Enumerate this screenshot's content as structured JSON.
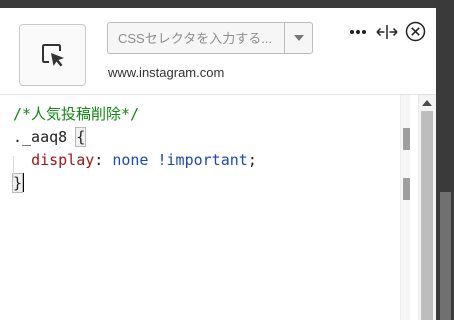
{
  "toolbar": {
    "element_picker_icon": "cursor-select-icon",
    "css_selector_placeholder": "CSSセレクタを入力する...",
    "dropdown_icon": "chevron-down-icon",
    "site_url": "www.instagram.com",
    "more_icon": "more-horizontal-icon",
    "resize_icon": "resize-horizontal-icon",
    "close_icon": "close-circle-icon"
  },
  "editor": {
    "lines": [
      {
        "comment": "/*人気投稿削除*/"
      },
      {
        "selector": "._aaq8",
        "brace": "{"
      },
      {
        "property": "display",
        "colon": ":",
        "value": "none",
        "important": "!important",
        "semicolon": ";"
      },
      {
        "brace": "}"
      }
    ]
  },
  "colors": {
    "comment": "#118811",
    "property": "#a31515",
    "value": "#1a4ab5",
    "dark_panel": "#3a3a3a"
  }
}
